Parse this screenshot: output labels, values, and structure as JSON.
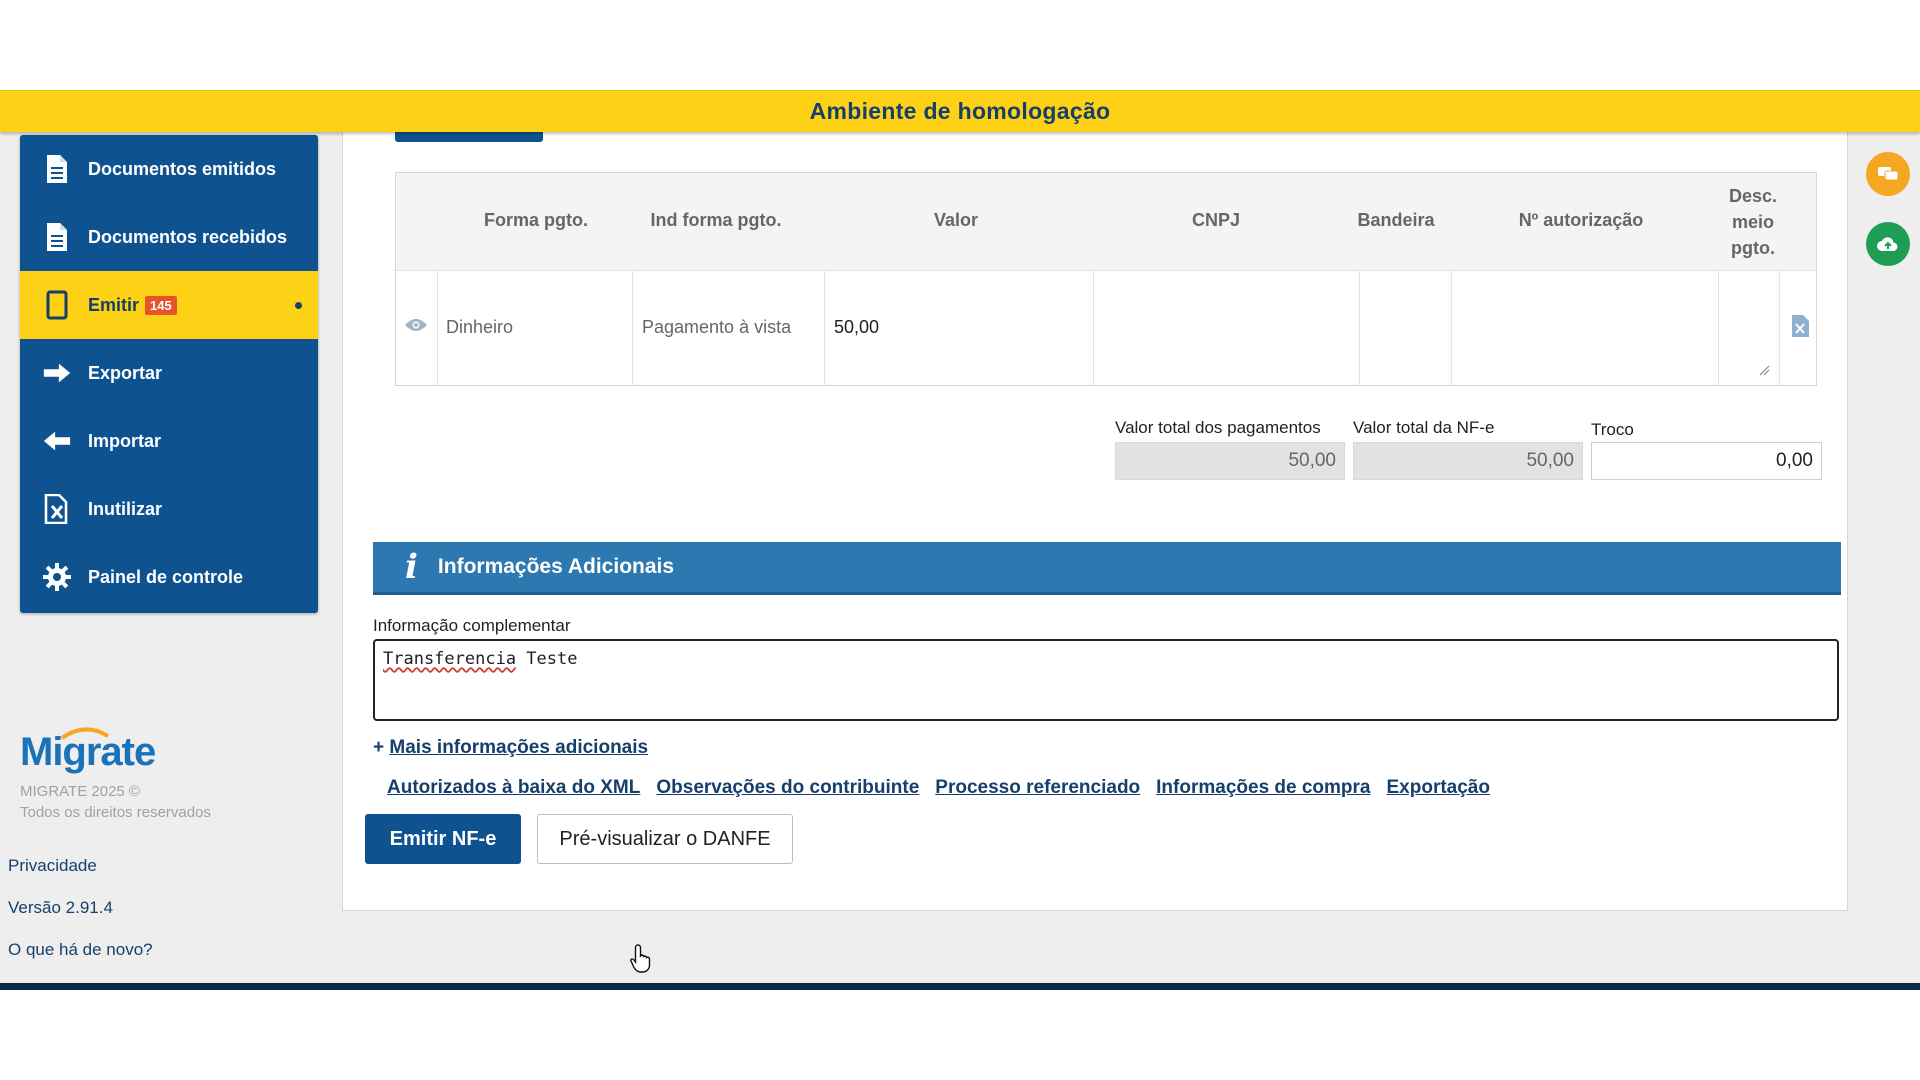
{
  "banner": {
    "text": "Ambiente de homologação"
  },
  "sidebar": {
    "items": [
      {
        "label": "Documentos emitidos",
        "icon": "document-icon"
      },
      {
        "label": "Documentos recebidos",
        "icon": "document-icon"
      },
      {
        "label": "Emitir",
        "icon": "page-icon",
        "badge": "145",
        "active": true
      },
      {
        "label": "Exportar",
        "icon": "arrow-right-icon"
      },
      {
        "label": "Importar",
        "icon": "arrow-left-icon"
      },
      {
        "label": "Inutilizar",
        "icon": "document-cancel-icon"
      },
      {
        "label": "Painel de controle",
        "icon": "gear-icon"
      }
    ]
  },
  "brand": {
    "logo": "Migrate",
    "copyright": "MIGRATE 2025 ©",
    "rights": "Todos os direitos reservados",
    "privacy": "Privacidade",
    "version": "Versão 2.91.4",
    "whats_new": "O que há de novo?"
  },
  "payments": {
    "headers": [
      "Forma pgto.",
      "Ind forma pgto.",
      "Valor",
      "CNPJ",
      "Bandeira",
      "Nº autorização",
      "Desc. meio pgto."
    ],
    "rows": [
      {
        "forma": "Dinheiro",
        "ind": "Pagamento à vista",
        "valor": "50,00",
        "cnpj": "",
        "bandeira": "",
        "autorizacao": "",
        "desc": ""
      }
    ]
  },
  "totals": {
    "pagamentos_label": "Valor total dos pagamentos",
    "pagamentos_value": "50,00",
    "nfe_label": "Valor total da NF-e",
    "nfe_value": "50,00",
    "troco_label": "Troco",
    "troco_value": "0,00"
  },
  "info": {
    "title": "Informações Adicionais",
    "complementar_label": "Informação complementar",
    "complementar_word1": "Transferencia",
    "complementar_word2": " Teste",
    "more_plus": "+",
    "more_label": "Mais informações adicionais",
    "links": [
      "Autorizados à baixa do XML",
      "Observações do contribuinte",
      "Processo referenciado",
      "Informações de compra",
      "Exportação"
    ]
  },
  "actions": {
    "emit_label": "Emitir NF-e",
    "preview_label": "Pré-visualizar o DANFE"
  },
  "colors": {
    "banner": "#fcd116",
    "sidebar": "#0f5290",
    "section_header": "#2e78b1",
    "link": "#16406b"
  }
}
